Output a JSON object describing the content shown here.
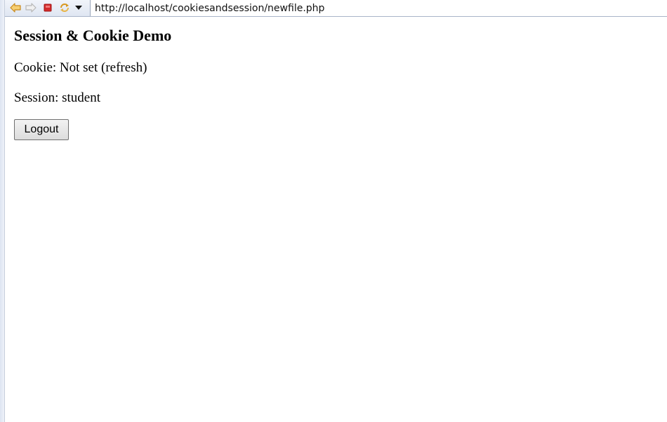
{
  "browser": {
    "address_url": "http://localhost/cookiesandsession/newfile.php",
    "icons": {
      "back": "back-arrow-icon",
      "forward": "forward-arrow-icon",
      "stop": "stop-icon",
      "refresh": "refresh-icon",
      "menu": "dropdown-triangle-icon"
    },
    "colors": {
      "back_arrow": "#e8a23a",
      "forward_arrow": "#d9d9d9",
      "stop": "#d42a2a",
      "refresh": "#e3a431"
    }
  },
  "page": {
    "title": "Session & Cookie Demo",
    "cookie_line": "Cookie: Not set (refresh)",
    "session_line": "Session: student",
    "logout_label": "Logout"
  }
}
